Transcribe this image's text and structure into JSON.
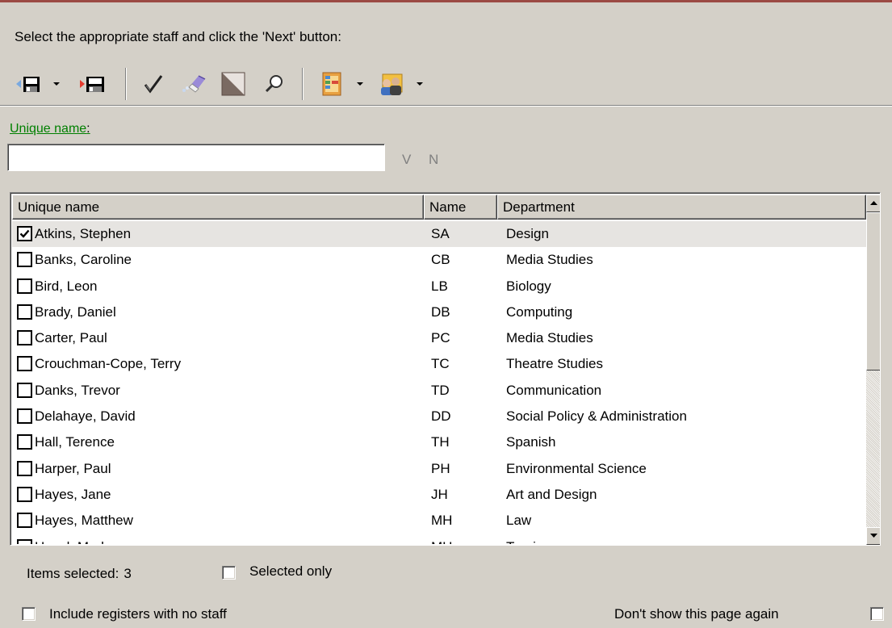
{
  "instruction": "Select the appropriate staff and click the 'Next' button:",
  "toolbar": {
    "icons": [
      "save-previous-icon",
      "dropdown-arrow-icon",
      "save-next-icon",
      "checkmark-icon",
      "eraser-icon",
      "invert-selection-icon",
      "magnifier-icon",
      "register-icon",
      "dropdown-arrow-icon",
      "staff-group-icon",
      "dropdown-arrow-icon"
    ]
  },
  "filter": {
    "label": "Unique name",
    "label_suffix": ":",
    "value": "",
    "v_label": "V",
    "n_label": "N"
  },
  "list": {
    "columns": [
      "Unique name",
      "Name",
      "Department"
    ],
    "rows": [
      {
        "unique_name": "Atkins, Stephen",
        "name": "SA",
        "department": "Design",
        "checked": true
      },
      {
        "unique_name": "Banks, Caroline",
        "name": "CB",
        "department": "Media Studies",
        "checked": false
      },
      {
        "unique_name": "Bird, Leon",
        "name": "LB",
        "department": "Biology",
        "checked": false
      },
      {
        "unique_name": "Brady, Daniel",
        "name": "DB",
        "department": "Computing",
        "checked": false
      },
      {
        "unique_name": "Carter, Paul",
        "name": "PC",
        "department": "Media Studies",
        "checked": false
      },
      {
        "unique_name": "Crouchman-Cope, Terry",
        "name": "TC",
        "department": "Theatre Studies",
        "checked": false
      },
      {
        "unique_name": "Danks, Trevor",
        "name": "TD",
        "department": "Communication",
        "checked": false
      },
      {
        "unique_name": "Delahaye, David",
        "name": "DD",
        "department": "Social Policy & Administration",
        "checked": false
      },
      {
        "unique_name": "Hall, Terence",
        "name": "TH",
        "department": "Spanish",
        "checked": false
      },
      {
        "unique_name": "Harper, Paul",
        "name": "PH",
        "department": "Environmental Science",
        "checked": false
      },
      {
        "unique_name": "Hayes, Jane",
        "name": "JH",
        "department": "Art and Design",
        "checked": false
      },
      {
        "unique_name": "Hayes, Matthew",
        "name": "MH",
        "department": "Law",
        "checked": false
      },
      {
        "unique_name": "Hazel, Mark",
        "name": "MH",
        "department": "Tourism",
        "checked": false
      }
    ]
  },
  "footer": {
    "items_selected_label": "Items selected:",
    "items_selected_count": "3",
    "selected_only_label": "Selected only",
    "include_registers_label": "Include registers with no staff",
    "dont_show_label": "Don't show this page again"
  },
  "colors": {
    "background": "#d4d0c8",
    "label_link": "#008000",
    "selected_row": "#e6e4e1",
    "top_accent": "#9b4a44"
  }
}
